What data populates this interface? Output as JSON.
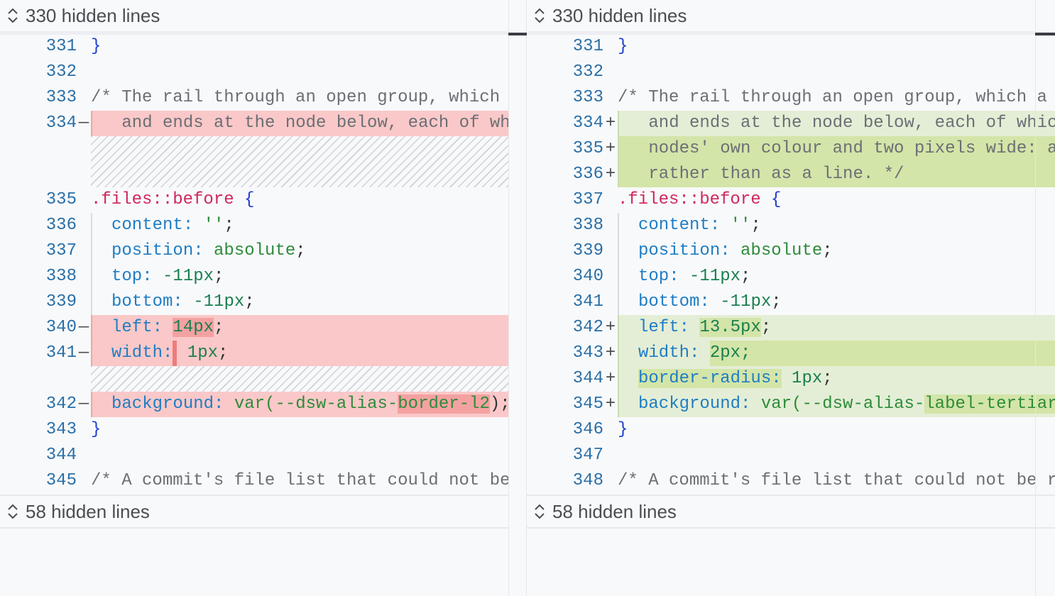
{
  "left": {
    "top_bar": "330 hidden lines",
    "bottom_bar": "58 hidden lines",
    "rows": [
      {
        "ln": "331",
        "mk": "",
        "tokens": [
          {
            "t": "}",
            "c": "c-brace"
          }
        ]
      },
      {
        "ln": "332",
        "mk": "",
        "tokens": []
      },
      {
        "ln": "333",
        "mk": "",
        "tokens": [
          {
            "t": "/* The rail through an open group, which a",
            "c": "c-comment"
          }
        ]
      },
      {
        "ln": "334",
        "mk": "—",
        "kind": "del",
        "indent": 1,
        "tokens": [
          {
            "t": " and ends at the node below, each of whic",
            "c": "c-comment"
          }
        ]
      },
      {
        "hatch": "tall"
      },
      {
        "ln": "335",
        "mk": "",
        "tokens": [
          {
            "t": ".files::before",
            "c": "c-sel"
          },
          {
            "t": " {",
            "c": "c-brace"
          }
        ]
      },
      {
        "ln": "336",
        "mk": "",
        "indent": 1,
        "tokens": [
          {
            "t": "content:",
            "c": "c-prop"
          },
          {
            "t": " ''",
            "c": "c-val"
          },
          {
            "t": ";",
            "c": "c-punc"
          }
        ]
      },
      {
        "ln": "337",
        "mk": "",
        "indent": 1,
        "tokens": [
          {
            "t": "position:",
            "c": "c-prop"
          },
          {
            "t": " absolute",
            "c": "c-val"
          },
          {
            "t": ";",
            "c": "c-punc"
          }
        ]
      },
      {
        "ln": "338",
        "mk": "",
        "indent": 1,
        "tokens": [
          {
            "t": "top:",
            "c": "c-prop"
          },
          {
            "t": " -11px",
            "c": "c-num"
          },
          {
            "t": ";",
            "c": "c-punc"
          }
        ]
      },
      {
        "ln": "339",
        "mk": "",
        "indent": 1,
        "tokens": [
          {
            "t": "bottom:",
            "c": "c-prop"
          },
          {
            "t": " -11px",
            "c": "c-num"
          },
          {
            "t": ";",
            "c": "c-punc"
          }
        ]
      },
      {
        "ln": "340",
        "mk": "—",
        "kind": "del",
        "indent": 1,
        "tokens": [
          {
            "t": "left: ",
            "c": "c-prop"
          },
          {
            "t": "14px",
            "c": "c-num",
            "hl": "hl-del"
          },
          {
            "t": ";",
            "c": "c-punc"
          }
        ]
      },
      {
        "ln": "341",
        "mk": "—",
        "kind": "del",
        "indent": 1,
        "tokens": [
          {
            "t": "width:",
            "c": "c-prop"
          },
          {
            "caret": true
          },
          {
            "t": " 1px",
            "c": "c-num"
          },
          {
            "t": ";",
            "c": "c-punc"
          }
        ]
      },
      {
        "hatch": "short"
      },
      {
        "ln": "342",
        "mk": "—",
        "kind": "del",
        "indent": 1,
        "tokens": [
          {
            "t": "background:",
            "c": "c-prop"
          },
          {
            "t": " var(--dsw-alias-",
            "c": "c-val"
          },
          {
            "t": "border-l2",
            "c": "c-val",
            "hl": "hl-del"
          },
          {
            "t": ");",
            "c": "c-punc"
          }
        ]
      },
      {
        "ln": "343",
        "mk": "",
        "tokens": [
          {
            "t": "}",
            "c": "c-brace"
          }
        ]
      },
      {
        "ln": "344",
        "mk": "",
        "tokens": []
      },
      {
        "ln": "345",
        "mk": "",
        "tokens": [
          {
            "t": "/* A commit's file list that could not be r",
            "c": "c-comment"
          }
        ]
      }
    ]
  },
  "right": {
    "top_bar": "330 hidden lines",
    "bottom_bar": "58 hidden lines",
    "rows": [
      {
        "ln": "331",
        "mk": "",
        "tokens": [
          {
            "t": "}",
            "c": "c-brace"
          }
        ]
      },
      {
        "ln": "332",
        "mk": "",
        "tokens": []
      },
      {
        "ln": "333",
        "mk": "",
        "tokens": [
          {
            "t": "/* The rail through an open group, which a gr",
            "c": "c-comment"
          }
        ]
      },
      {
        "ln": "334",
        "mk": "+",
        "kind": "add",
        "indent": 1,
        "tokens": [
          {
            "t": " and ends at the node below, each of which",
            "c": "c-comment"
          }
        ]
      },
      {
        "ln": "335",
        "mk": "+",
        "kind": "add-strong",
        "indent": 1,
        "tokens": [
          {
            "t": " nodes' own colour and two pixels wide: at",
            "c": "c-comment"
          }
        ]
      },
      {
        "ln": "336",
        "mk": "+",
        "kind": "add-strong",
        "indent": 1,
        "tokens": [
          {
            "t": " rather than as a line. */",
            "c": "c-comment"
          }
        ]
      },
      {
        "ln": "337",
        "mk": "",
        "tokens": [
          {
            "t": ".files::before",
            "c": "c-sel"
          },
          {
            "t": " {",
            "c": "c-brace"
          }
        ]
      },
      {
        "ln": "338",
        "mk": "",
        "indent": 1,
        "tokens": [
          {
            "t": "content:",
            "c": "c-prop"
          },
          {
            "t": " ''",
            "c": "c-val"
          },
          {
            "t": ";",
            "c": "c-punc"
          }
        ]
      },
      {
        "ln": "339",
        "mk": "",
        "indent": 1,
        "tokens": [
          {
            "t": "position:",
            "c": "c-prop"
          },
          {
            "t": " absolute",
            "c": "c-val"
          },
          {
            "t": ";",
            "c": "c-punc"
          }
        ]
      },
      {
        "ln": "340",
        "mk": "",
        "indent": 1,
        "tokens": [
          {
            "t": "top:",
            "c": "c-prop"
          },
          {
            "t": " -11px",
            "c": "c-num"
          },
          {
            "t": ";",
            "c": "c-punc"
          }
        ]
      },
      {
        "ln": "341",
        "mk": "",
        "indent": 1,
        "tokens": [
          {
            "t": "bottom:",
            "c": "c-prop"
          },
          {
            "t": " -11px",
            "c": "c-num"
          },
          {
            "t": ";",
            "c": "c-punc"
          }
        ]
      },
      {
        "ln": "342",
        "mk": "+",
        "kind": "add",
        "indent": 1,
        "tokens": [
          {
            "t": "left: ",
            "c": "c-prop"
          },
          {
            "t": "13.5px",
            "c": "c-num",
            "hl": "hl-add"
          },
          {
            "t": ";",
            "c": "c-punc"
          }
        ]
      },
      {
        "ln": "343",
        "mk": "+",
        "kind": "add",
        "indent": 1,
        "tokens": [
          {
            "t": "width: ",
            "c": "c-prop"
          },
          {
            "t": "2px;",
            "c": "c-num",
            "hl": "hl-add",
            "fill": true
          }
        ]
      },
      {
        "ln": "344",
        "mk": "+",
        "kind": "add",
        "indent": 1,
        "tokens": [
          {
            "t": "border-radius:",
            "c": "c-prop",
            "hl": "hl-add"
          },
          {
            "t": " 1px",
            "c": "c-num"
          },
          {
            "t": ";",
            "c": "c-punc"
          }
        ]
      },
      {
        "ln": "345",
        "mk": "+",
        "kind": "add",
        "indent": 1,
        "tokens": [
          {
            "t": "background:",
            "c": "c-prop"
          },
          {
            "t": " var(--dsw-alias-",
            "c": "c-val"
          },
          {
            "t": "label-tertiary",
            "c": "c-val",
            "hl": "hl-add"
          },
          {
            "t": ")",
            "c": "c-punc"
          }
        ]
      },
      {
        "ln": "346",
        "mk": "",
        "tokens": [
          {
            "t": "}",
            "c": "c-brace"
          }
        ]
      },
      {
        "ln": "347",
        "mk": "",
        "tokens": []
      },
      {
        "ln": "348",
        "mk": "",
        "tokens": [
          {
            "t": "/* A commit's file list that could not be rea",
            "c": "c-comment"
          }
        ]
      }
    ]
  }
}
